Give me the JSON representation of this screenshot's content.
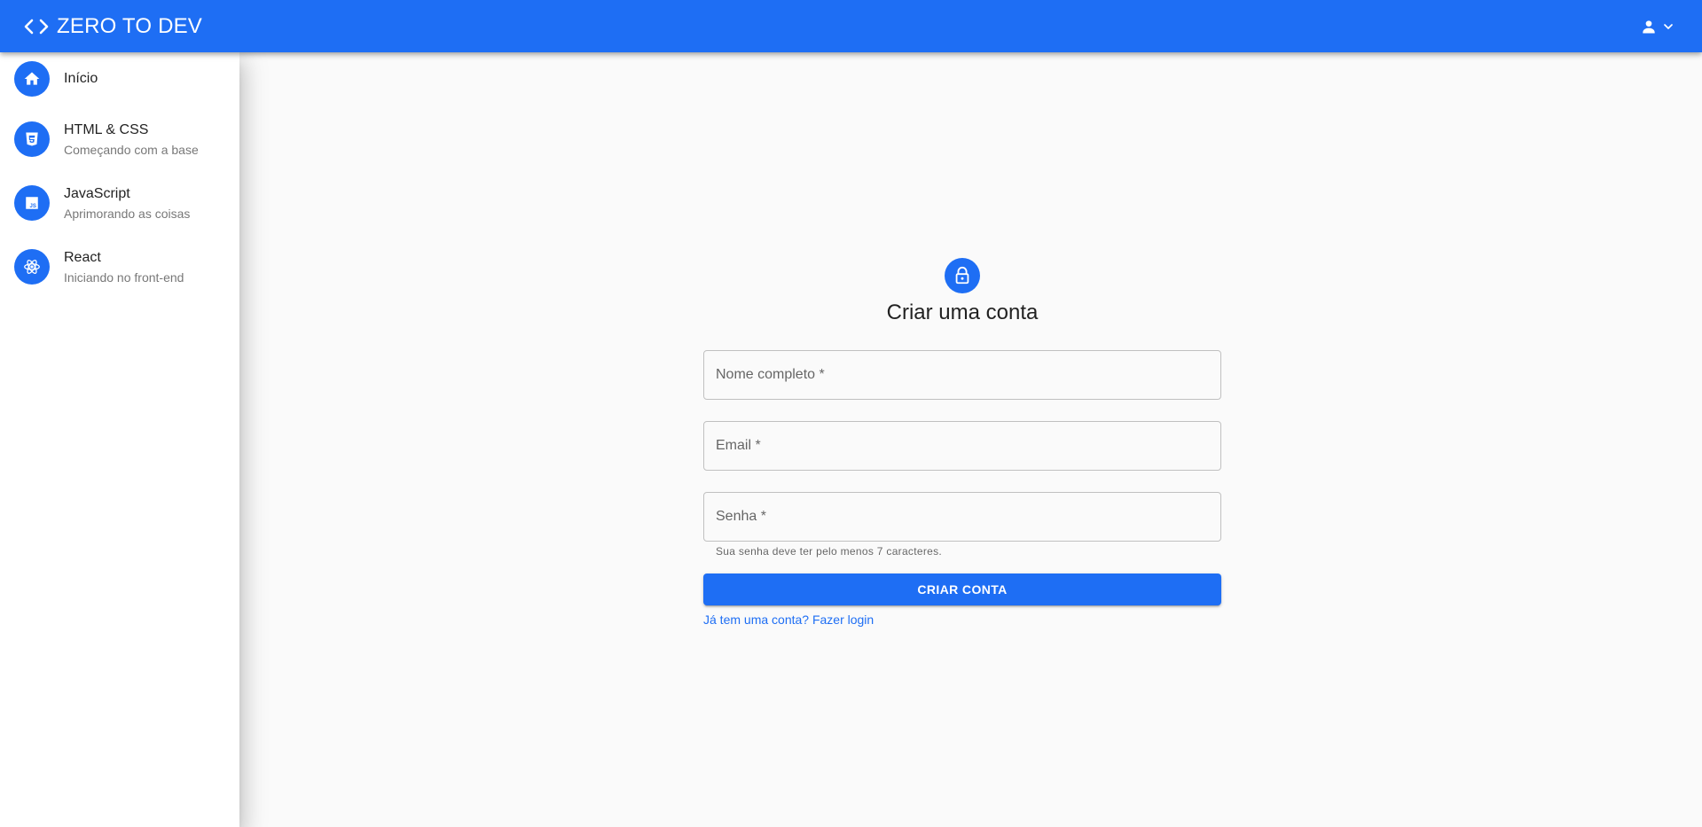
{
  "colors": {
    "primary": "#1e6ef4",
    "background": "#fafafa",
    "drawer": "#ffffff"
  },
  "header": {
    "brand_icon": "code-icon",
    "title": "ZERO TO DEV",
    "account_icon": "person-icon",
    "account_menu_icon": "chevron-down-icon"
  },
  "sidebar": {
    "items": [
      {
        "icon": "home-icon",
        "label": "Início",
        "sublabel": ""
      },
      {
        "icon": "html5-icon",
        "label": "HTML & CSS",
        "sublabel": "Começando com a base"
      },
      {
        "icon": "javascript-icon",
        "label": "JavaScript",
        "sublabel": "Aprimorando as coisas"
      },
      {
        "icon": "react-icon",
        "label": "React",
        "sublabel": "Iniciando no front-end"
      }
    ]
  },
  "form": {
    "icon": "lock-icon",
    "title": "Criar uma conta",
    "fields": {
      "name": {
        "placeholder": "Nome completo *",
        "value": ""
      },
      "email": {
        "placeholder": "Email *",
        "value": ""
      },
      "password": {
        "placeholder": "Senha *",
        "value": "",
        "helper": "Sua senha deve ter pelo menos 7 caracteres."
      }
    },
    "submit_label": "CRIAR CONTA",
    "login_link": "Já tem uma conta? Fazer login"
  }
}
